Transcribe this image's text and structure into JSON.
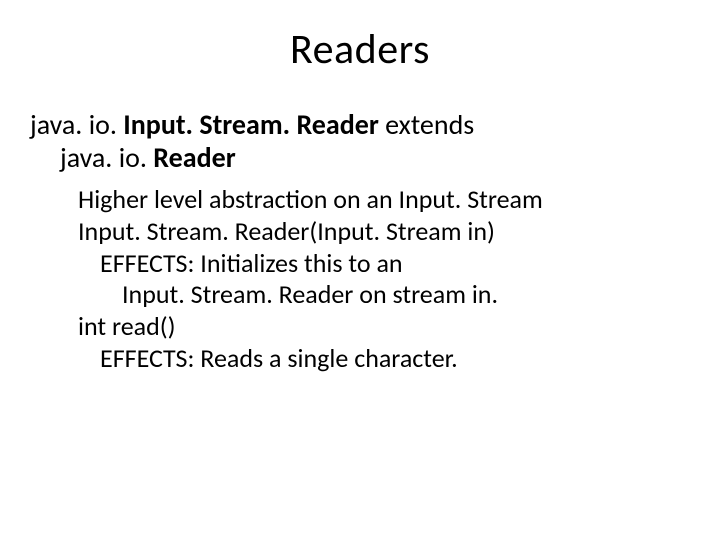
{
  "title": "Readers",
  "decl": {
    "part1": "java. io. ",
    "bold1": "Input. Stream. Reader",
    "part2": " extends",
    "line2_pre": "java. io. ",
    "line2_bold": "Reader"
  },
  "spec": {
    "l1": "Higher level abstraction on an Input. Stream",
    "l2": "Input. Stream. Reader(Input. Stream in)",
    "l3": "EFFECTS: Initializes this to an",
    "l4": "Input. Stream. Reader on stream in.",
    "l5": "int read()",
    "l6": "EFFECTS: Reads a single character."
  }
}
